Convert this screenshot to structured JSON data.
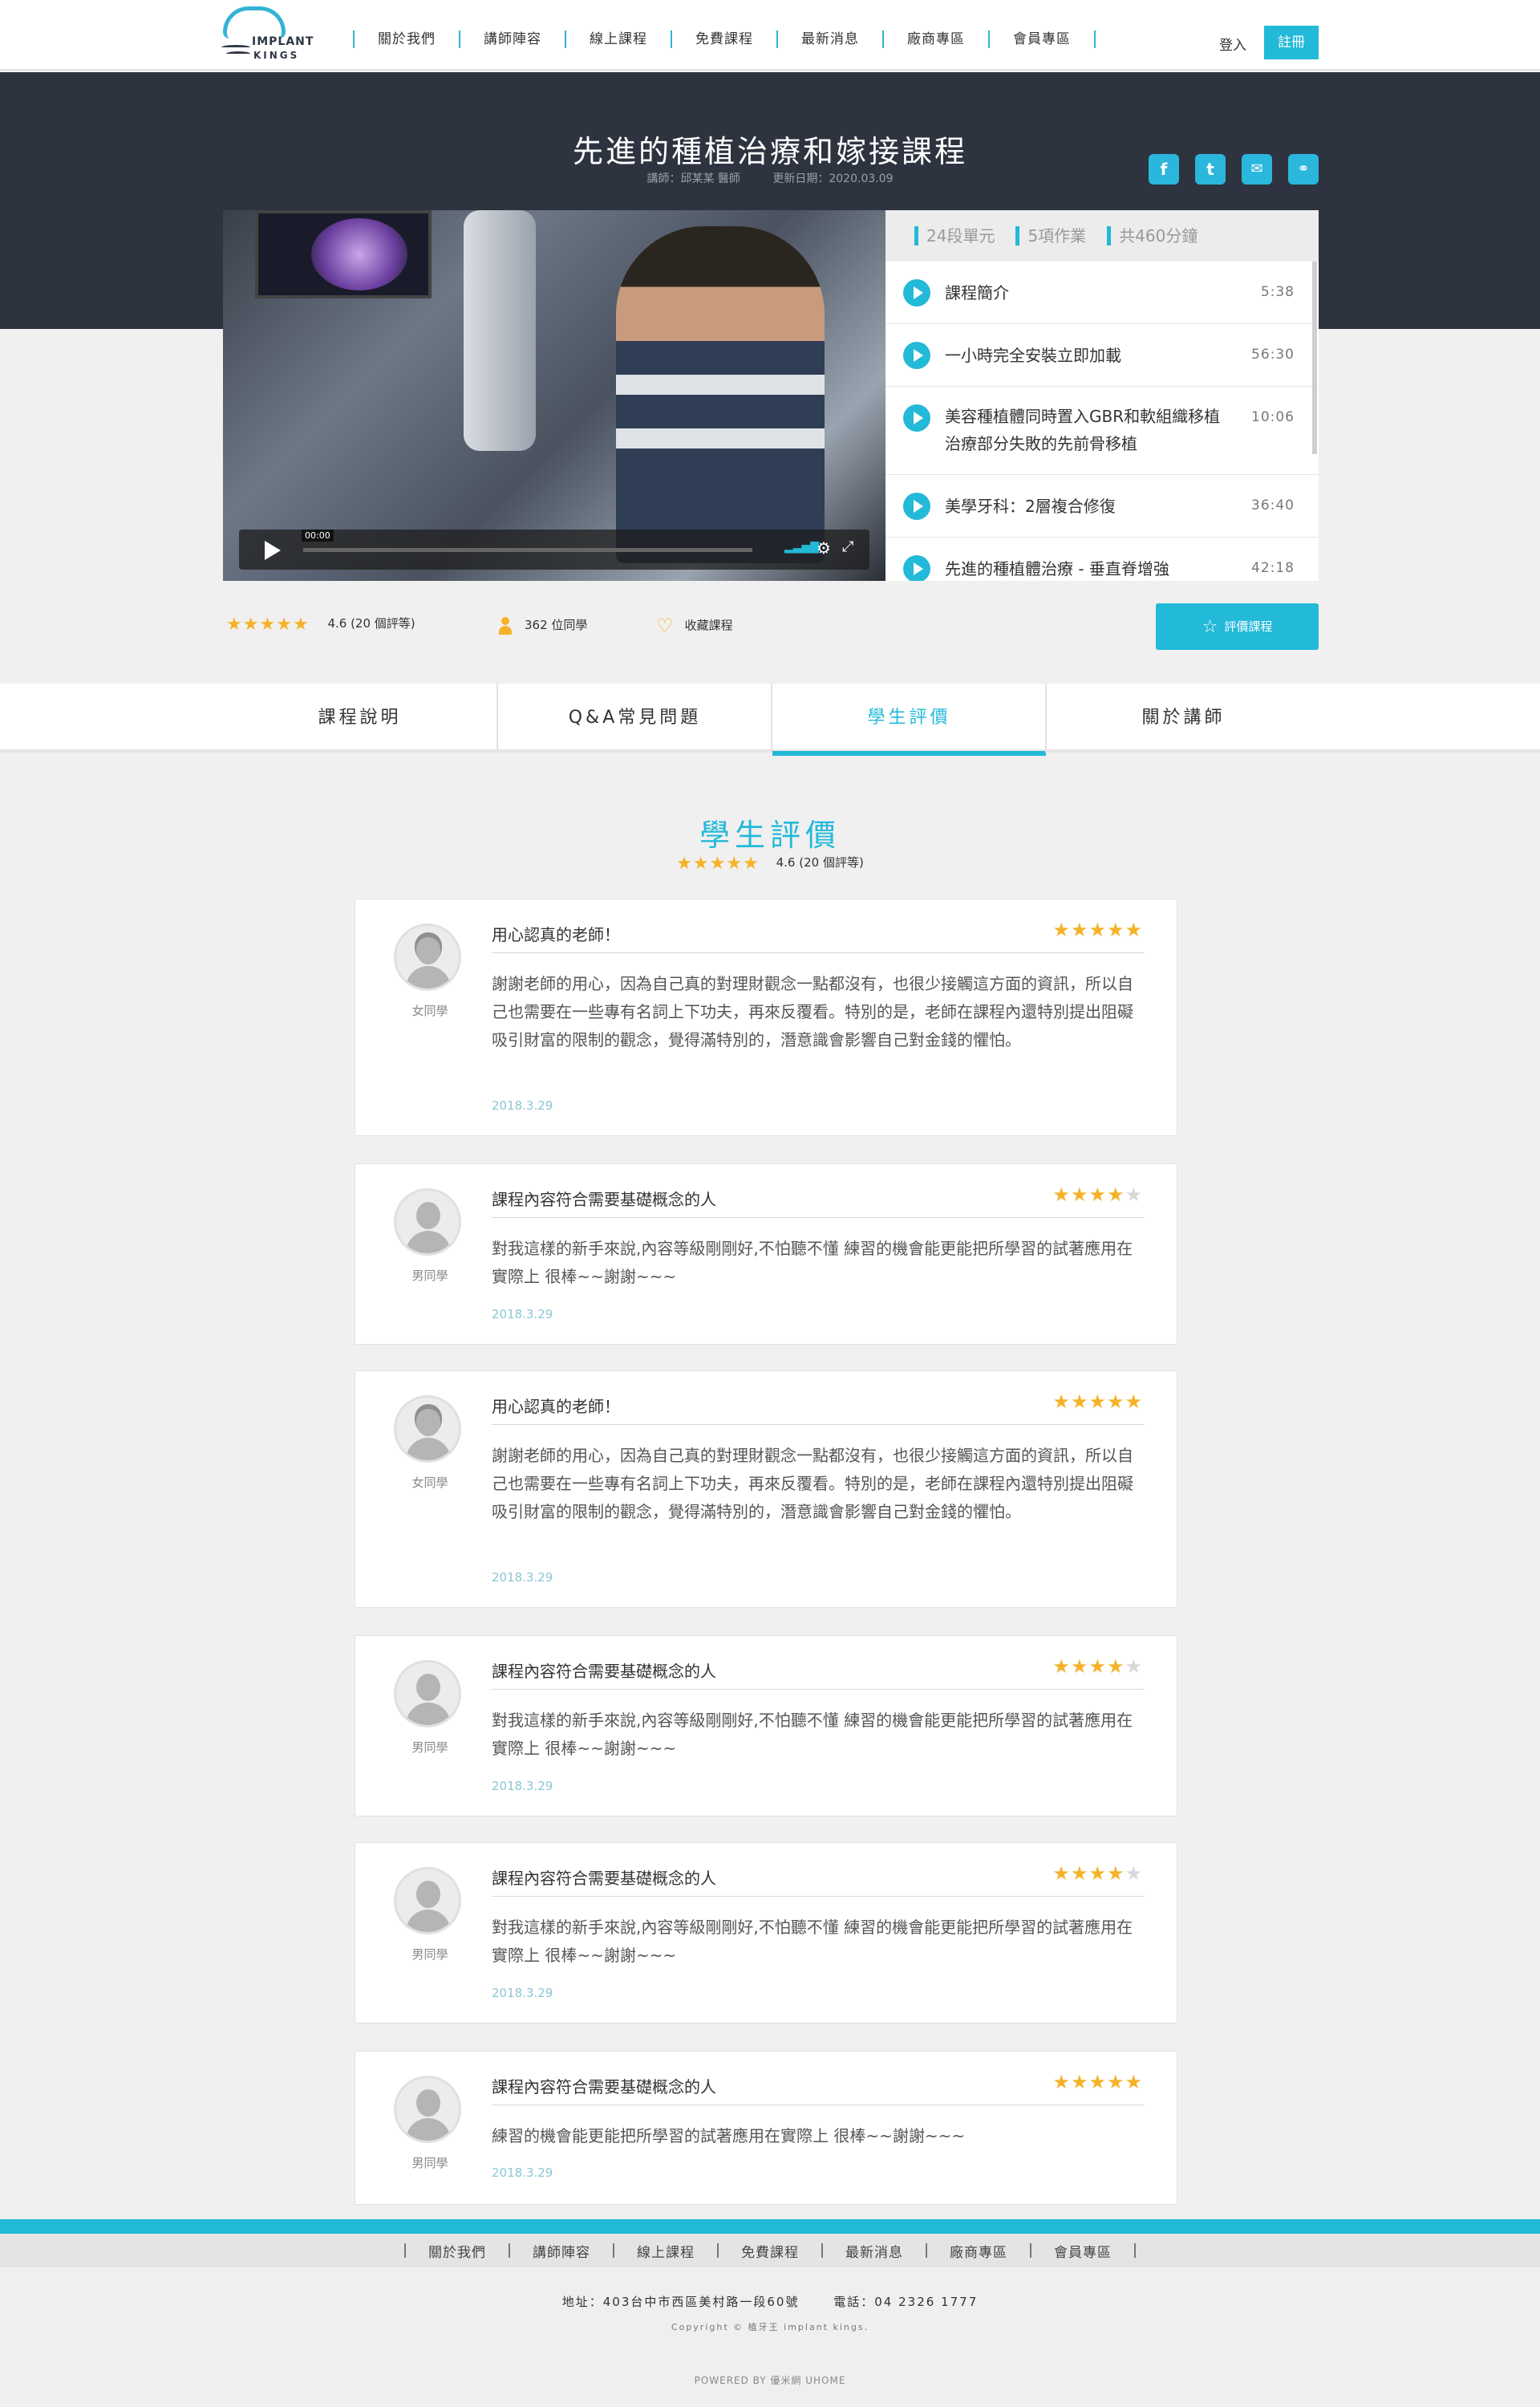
{
  "brand": {
    "line1": "IMPLANT",
    "line2": "KINGS"
  },
  "nav": [
    "關於我們",
    "講師陣容",
    "線上課程",
    "免費課程",
    "最新消息",
    "廠商專區",
    "會員專區"
  ],
  "auth": {
    "login": "登入",
    "register": "註冊"
  },
  "course": {
    "title": "先進的種植治療和嫁接課程",
    "instructor": "講師：邱某某 醫師",
    "updated": "更新日期：2020.03.09"
  },
  "share_icons": [
    "facebook-icon",
    "twitter-icon",
    "mail-icon",
    "link-icon"
  ],
  "video": {
    "time": "00:00"
  },
  "playlist": {
    "stats": [
      "24段單元",
      "5項作業",
      "共460分鐘"
    ],
    "items": [
      {
        "name": "課程簡介",
        "duration": "5:38"
      },
      {
        "name": "一小時完全安裝立即加載",
        "duration": "56:30"
      },
      {
        "name": "美容種植體同時置入GBR和軟組織移植治療部分失敗的先前骨移植",
        "duration": "10:06"
      },
      {
        "name": "美學牙科：2層複合修復",
        "duration": "36:40"
      },
      {
        "name": "先進的種植體治療 - 垂直脊增強",
        "duration": "42:18"
      }
    ]
  },
  "stats": {
    "rating": 4.6,
    "rating_text": "4.6  (20 個評等)",
    "students": "362 位同學",
    "favorite": "收藏課程",
    "rate_button": "評價課程"
  },
  "tabs": [
    "課程說明",
    "Q&A常見問題",
    "學生評價",
    "關於講師"
  ],
  "active_tab": 2,
  "reviews_section": {
    "title": "學生評價",
    "rating": 4.6,
    "summary": "4.6  (20 個評等)"
  },
  "reviews": [
    {
      "title": "用心認真的老師！",
      "stars": 5,
      "role": "女同學",
      "body": "謝謝老師的用心，因為自己真的對理財觀念一點都沒有，也很少接觸這方面的資訊，所以自己也需要在一些專有名詞上下功夫，再來反覆看。特別的是，老師在課程內還特別提出阻礙吸引財富的限制的觀念，覺得滿特別的，潛意識會影響自己對金錢的懼怕。",
      "date": "2018.3.29"
    },
    {
      "title": "課程內容符合需要基礎概念的人",
      "stars": 4,
      "role": "男同學",
      "body": "對我這樣的新手來說,內容等級剛剛好,不怕聽不懂 練習的機會能更能把所學習的試著應用在實際上 很棒~~謝謝~~~",
      "date": "2018.3.29"
    },
    {
      "title": "用心認真的老師！",
      "stars": 5,
      "role": "女同學",
      "body": "謝謝老師的用心，因為自己真的對理財觀念一點都沒有，也很少接觸這方面的資訊，所以自己也需要在一些專有名詞上下功夫，再來反覆看。特別的是，老師在課程內還特別提出阻礙吸引財富的限制的觀念，覺得滿特別的，潛意識會影響自己對金錢的懼怕。",
      "date": "2018.3.29"
    },
    {
      "title": "課程內容符合需要基礎概念的人",
      "stars": 4,
      "role": "男同學",
      "body": "對我這樣的新手來說,內容等級剛剛好,不怕聽不懂 練習的機會能更能把所學習的試著應用在實際上 很棒~~謝謝~~~",
      "date": "2018.3.29"
    },
    {
      "title": "課程內容符合需要基礎概念的人",
      "stars": 4,
      "role": "男同學",
      "body": "對我這樣的新手來說,內容等級剛剛好,不怕聽不懂 練習的機會能更能把所學習的試著應用在實際上 很棒~~謝謝~~~",
      "date": "2018.3.29"
    },
    {
      "title": "課程內容符合需要基礎概念的人",
      "stars": 5,
      "role": "男同學",
      "body": "練習的機會能更能把所學習的試著應用在實際上 很棒~~謝謝~~~",
      "date": "2018.3.29"
    }
  ],
  "footer": {
    "nav": [
      "關於我們",
      "講師陣容",
      "線上課程",
      "免費課程",
      "最新消息",
      "廠商專區",
      "會員專區"
    ],
    "address": "地址：403台中市西區美村路一段60號",
    "phone": "電話：04 2326 1777",
    "copyright": "Copyright © 植牙王 implant kings.",
    "powered": "POWERED BY    優米網 UHOME"
  },
  "colors": {
    "accent": "#23b9d8",
    "star": "#f5b228",
    "hero_bg": "#2e3340"
  }
}
